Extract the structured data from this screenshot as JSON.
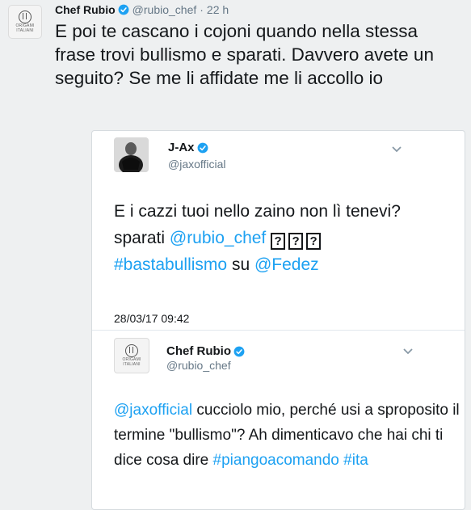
{
  "tweet": {
    "author_name": "Chef Rubio",
    "handle": "@rubio_chef",
    "separator": "·",
    "time": "22 h",
    "text": "E poi te cascano i cojoni quando nella stessa frase trovi bullismo e sparati. Davvero avete un seguito? Se me li affidate me li accollo io",
    "avatar_logo_text": [
      "ORIGAMI",
      "ITALIANI"
    ]
  },
  "quoted": {
    "author_name": "J-Ax",
    "handle": "@jaxofficial",
    "text_line1": "E i cazzi tuoi nello zaino non lì tenevi?",
    "text_sparati": "sparati",
    "mention1": "@rubio_chef",
    "unknown_glyphs": [
      "?",
      "?",
      "?"
    ],
    "hashtag": "#bastabullismo",
    "text_su": "su",
    "mention2": "@Fedez",
    "date": "28/03/17 09:42"
  },
  "reply": {
    "author_name": "Chef Rubio",
    "handle": "@rubio_chef",
    "mention": "@jaxofficial",
    "text_body": "cucciolo mio, perché usi a sproposito il termine \"bullismo\"? Ah dimenticavo che hai chi ti dice cosa dire",
    "hashtag1": "#piangoacomando",
    "hashtag2": "#ita",
    "avatar_logo_text": [
      "ORIGAMI",
      "ITALIANI"
    ]
  },
  "colors": {
    "link": "#1da1f2",
    "verified": "#1da1f2",
    "background": "#eef0f1"
  },
  "icons": [
    "verified-badge-icon",
    "chevron-down-icon"
  ]
}
